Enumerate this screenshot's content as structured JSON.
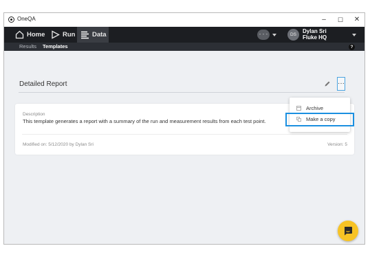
{
  "window": {
    "title": "OneQA",
    "minimize": "–",
    "maximize": "☐",
    "close": "✕"
  },
  "nav": {
    "items": [
      {
        "label": "Home",
        "icon": "home-icon"
      },
      {
        "label": "Run",
        "icon": "play-icon"
      },
      {
        "label": "Data",
        "icon": "data-icon",
        "active": true
      }
    ],
    "status_indicator": "- - -",
    "user": {
      "initials": "DS",
      "name": "Dylan Sri",
      "org": "Fluke HQ"
    }
  },
  "subnav": {
    "tabs": [
      {
        "label": "Results",
        "active": false
      },
      {
        "label": "Templates",
        "active": true
      }
    ],
    "help": "?"
  },
  "page": {
    "title": "Detailed Report",
    "more_button": "···"
  },
  "card": {
    "description_label": "Description",
    "description": "This template generates a report with a summary of the run and measurement results from each test point.",
    "modified": "Modified on: 5/12/2020 by Dylan Sri",
    "version": "Version: 5"
  },
  "menu": {
    "items": [
      {
        "label": "Archive",
        "icon": "archive-icon"
      },
      {
        "label": "Make a copy",
        "icon": "copy-icon"
      }
    ]
  },
  "colors": {
    "nav_bg": "#1c1e22",
    "subnav_bg": "#2c2f35",
    "content_bg": "#eef0f3",
    "highlight": "#1a8fe0",
    "chat_button": "#f7c325"
  }
}
